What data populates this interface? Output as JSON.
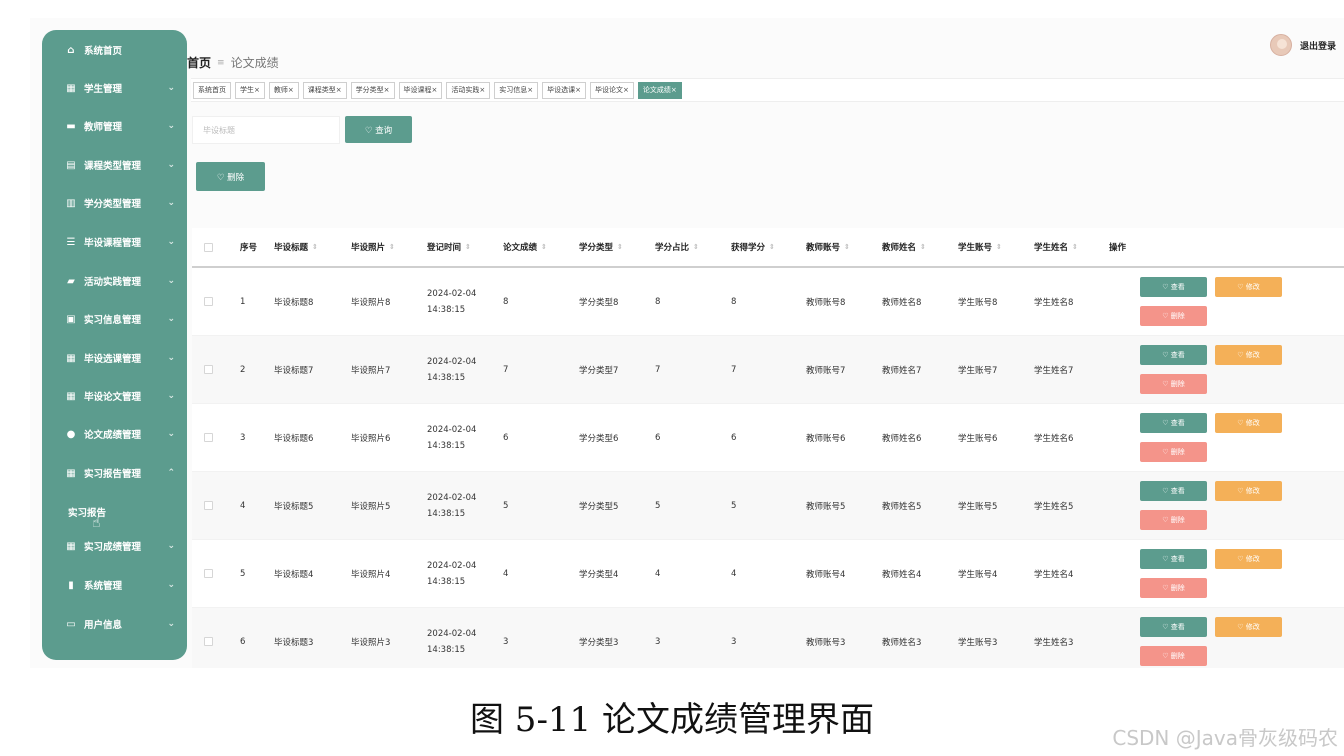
{
  "sidebar": {
    "items": [
      {
        "label": "系统首页",
        "icon": "home-icon",
        "glyph": "⌂",
        "chevron": ""
      },
      {
        "label": "学生管理",
        "icon": "grid-icon",
        "glyph": "▦",
        "chevron": "⌄"
      },
      {
        "label": "教师管理",
        "icon": "briefcase-icon",
        "glyph": "▬",
        "chevron": "⌄"
      },
      {
        "label": "课程类型管理",
        "icon": "document-icon",
        "glyph": "▤",
        "chevron": "⌄"
      },
      {
        "label": "学分类型管理",
        "icon": "bar-icon",
        "glyph": "▥",
        "chevron": "⌄"
      },
      {
        "label": "毕设课程管理",
        "icon": "menu-icon",
        "glyph": "☰",
        "chevron": "⌄"
      },
      {
        "label": "活动实践管理",
        "icon": "folder-icon",
        "glyph": "▰",
        "chevron": "⌄"
      },
      {
        "label": "实习信息管理",
        "icon": "file-icon",
        "glyph": "▣",
        "chevron": "⌄"
      },
      {
        "label": "毕设选课管理",
        "icon": "grid-icon",
        "glyph": "▦",
        "chevron": "⌄"
      },
      {
        "label": "毕设论文管理",
        "icon": "grid-icon",
        "glyph": "▦",
        "chevron": "⌄"
      },
      {
        "label": "论文成绩管理",
        "icon": "bulb-icon",
        "glyph": "●",
        "chevron": "⌄"
      },
      {
        "label": "实习报告管理",
        "icon": "table-icon",
        "glyph": "▦",
        "chevron": "⌃"
      },
      {
        "label": "实习成绩管理",
        "icon": "grid-icon",
        "glyph": "▦",
        "chevron": "⌄"
      },
      {
        "label": "系统管理",
        "icon": "chart-icon",
        "glyph": "▮",
        "chevron": "⌄"
      },
      {
        "label": "用户信息",
        "icon": "card-icon",
        "glyph": "▭",
        "chevron": "⌄"
      }
    ],
    "sub_item": "实习报告"
  },
  "header": {
    "home": "首页",
    "separator": "≡",
    "current": "论文成绩",
    "logout": "退出登录"
  },
  "tags": [
    {
      "label": "系统首页"
    },
    {
      "label": "学生×"
    },
    {
      "label": "教师×"
    },
    {
      "label": "课程类型×"
    },
    {
      "label": "学分类型×"
    },
    {
      "label": "毕设课程×"
    },
    {
      "label": "活动实践×"
    },
    {
      "label": "实习信息×"
    },
    {
      "label": "毕设选课×"
    },
    {
      "label": "毕设论文×"
    },
    {
      "label": "论文成绩×"
    }
  ],
  "active_tag": 10,
  "search": {
    "placeholder": "毕设标题",
    "button": "♡ 查询"
  },
  "toolbar": {
    "delete": "♡ 删除"
  },
  "table": {
    "columns": [
      "",
      "序号",
      "毕设标题",
      "毕设照片",
      "登记时间",
      "论文成绩",
      "学分类型",
      "学分占比",
      "获得学分",
      "教师账号",
      "教师姓名",
      "学生账号",
      "学生姓名",
      "操作"
    ],
    "sortable": [
      false,
      false,
      true,
      true,
      true,
      true,
      true,
      true,
      true,
      true,
      true,
      true,
      true,
      false
    ],
    "sort_glyph": "⇕",
    "rows": [
      {
        "no": "1",
        "title": "毕设标题8",
        "photo": "毕设照片8",
        "date": "2024-02-04",
        "time": "14:38:15",
        "score": "8",
        "credit_type": "学分类型8",
        "ratio": "8",
        "credits": "8",
        "teacher_acc": "教师账号8",
        "teacher_name": "教师姓名8",
        "student_acc": "学生账号8",
        "student_name": "学生姓名8"
      },
      {
        "no": "2",
        "title": "毕设标题7",
        "photo": "毕设照片7",
        "date": "2024-02-04",
        "time": "14:38:15",
        "score": "7",
        "credit_type": "学分类型7",
        "ratio": "7",
        "credits": "7",
        "teacher_acc": "教师账号7",
        "teacher_name": "教师姓名7",
        "student_acc": "学生账号7",
        "student_name": "学生姓名7"
      },
      {
        "no": "3",
        "title": "毕设标题6",
        "photo": "毕设照片6",
        "date": "2024-02-04",
        "time": "14:38:15",
        "score": "6",
        "credit_type": "学分类型6",
        "ratio": "6",
        "credits": "6",
        "teacher_acc": "教师账号6",
        "teacher_name": "教师姓名6",
        "student_acc": "学生账号6",
        "student_name": "学生姓名6"
      },
      {
        "no": "4",
        "title": "毕设标题5",
        "photo": "毕设照片5",
        "date": "2024-02-04",
        "time": "14:38:15",
        "score": "5",
        "credit_type": "学分类型5",
        "ratio": "5",
        "credits": "5",
        "teacher_acc": "教师账号5",
        "teacher_name": "教师姓名5",
        "student_acc": "学生账号5",
        "student_name": "学生姓名5"
      },
      {
        "no": "5",
        "title": "毕设标题4",
        "photo": "毕设照片4",
        "date": "2024-02-04",
        "time": "14:38:15",
        "score": "4",
        "credit_type": "学分类型4",
        "ratio": "4",
        "credits": "4",
        "teacher_acc": "教师账号4",
        "teacher_name": "教师姓名4",
        "student_acc": "学生账号4",
        "student_name": "学生姓名4"
      },
      {
        "no": "6",
        "title": "毕设标题3",
        "photo": "毕设照片3",
        "date": "2024-02-04",
        "time": "14:38:15",
        "score": "3",
        "credit_type": "学分类型3",
        "ratio": "3",
        "credits": "3",
        "teacher_acc": "教师账号3",
        "teacher_name": "教师姓名3",
        "student_acc": "学生账号3",
        "student_name": "学生姓名3"
      }
    ],
    "actions": {
      "view": "♡ 查看",
      "edit": "♡ 修改",
      "delete": "♡ 删除"
    }
  },
  "caption": "图 5-11 论文成绩管理界面",
  "watermark": "CSDN @Java骨灰级码农",
  "colors": {
    "accent": "#5c9c8e",
    "edit": "#f4b058",
    "danger": "#f4948a"
  }
}
